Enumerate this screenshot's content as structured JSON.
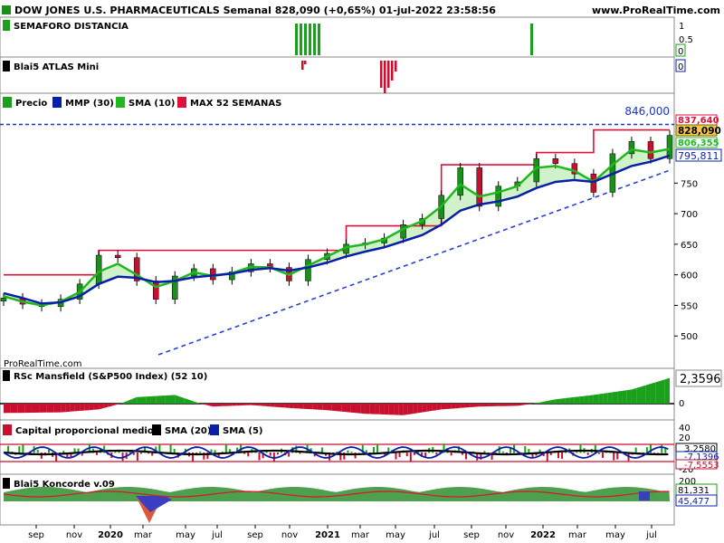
{
  "header": {
    "title": "DOW JONES U.S. PHARMACEUTICALS Semanal 828,090 (+0,65%) 01-jul-2022 23:58:56",
    "site": "www.ProRealTime.com"
  },
  "watermark": "ProRealTime.com",
  "panels": {
    "semaforo": {
      "label": "SEMAFORO DISTANCIA",
      "ticks": [
        "1",
        "0.5",
        "0"
      ],
      "last_value": "0"
    },
    "atlas": {
      "label": "Blai5 ATLAS Mini",
      "ticks": [
        "0"
      ],
      "last_value": "0"
    },
    "price": {
      "legend": [
        "Precio",
        "MMP (30)",
        "SMA (10)",
        "MAX 52 SEMANAS"
      ],
      "ticks": [
        "750",
        "700",
        "650",
        "600",
        "550",
        "500"
      ],
      "label_846": "846,000",
      "val_max": "837,640",
      "val_price": "828,090",
      "val_sma": "806,355",
      "val_mmp": "795,811"
    },
    "rsc": {
      "label": "RSc Mansfield (S&P500 Index) (52 10)",
      "ticks": [
        "0"
      ],
      "value": "2,3596"
    },
    "capital": {
      "legend": [
        "Capital proporcional medio",
        "SMA (20)",
        "SMA (5)"
      ],
      "ticks": [
        "40",
        "20",
        "0",
        "-20"
      ],
      "values": [
        "3,2580",
        "-7,1396",
        "-7,5553"
      ]
    },
    "koncorde": {
      "label": "Blai5 Koncorde v.09",
      "ticks": [
        "200"
      ],
      "values": [
        "81,331",
        "45,477"
      ]
    }
  },
  "x_axis": [
    "sep",
    "nov",
    "2020",
    "mar",
    "may",
    "jul",
    "sep",
    "nov",
    "2021",
    "mar",
    "may",
    "jul",
    "sep",
    "nov",
    "2022",
    "mar",
    "may",
    "jul"
  ],
  "colors": {
    "up": "#1a8f1a",
    "down": "#c8102e",
    "mmp": "#0a1fa8",
    "sma10": "#1fb81f",
    "max52": "#e0103a",
    "trend": "#2a3fd6",
    "bar_green": "#1aa01a",
    "bar_red": "#c8102e"
  },
  "chart_data": [
    {
      "type": "line",
      "title": "DOW JONES U.S. PHARMACEUTICALS Semanal",
      "x": [
        "2019-08",
        "2019-09",
        "2019-10",
        "2019-11",
        "2019-12",
        "2020-01",
        "2020-02",
        "2020-03",
        "2020-04",
        "2020-05",
        "2020-06",
        "2020-07",
        "2020-08",
        "2020-09",
        "2020-10",
        "2020-11",
        "2020-12",
        "2021-01",
        "2021-02",
        "2021-03",
        "2021-04",
        "2021-05",
        "2021-06",
        "2021-07",
        "2021-08",
        "2021-09",
        "2021-10",
        "2021-11",
        "2021-12",
        "2022-01",
        "2022-02",
        "2022-03",
        "2022-04",
        "2022-05",
        "2022-06",
        "2022-07"
      ],
      "series": [
        {
          "name": "Precio",
          "values": [
            562,
            552,
            548,
            560,
            585,
            632,
            628,
            590,
            560,
            598,
            610,
            592,
            605,
            618,
            612,
            590,
            625,
            635,
            650,
            652,
            660,
            682,
            692,
            730,
            775,
            712,
            745,
            752,
            790,
            782,
            765,
            735,
            798,
            818,
            790,
            828
          ]
        },
        {
          "name": "MMP (30)",
          "values": [
            570,
            562,
            553,
            555,
            565,
            585,
            597,
            595,
            588,
            590,
            596,
            599,
            602,
            608,
            611,
            607,
            612,
            620,
            630,
            638,
            645,
            655,
            665,
            682,
            705,
            715,
            720,
            728,
            742,
            752,
            755,
            752,
            765,
            778,
            785,
            795
          ]
        },
        {
          "name": "SMA (10)",
          "values": [
            565,
            556,
            550,
            556,
            572,
            605,
            618,
            600,
            580,
            590,
            604,
            598,
            603,
            613,
            612,
            600,
            615,
            630,
            645,
            650,
            658,
            675,
            688,
            712,
            748,
            728,
            735,
            745,
            775,
            778,
            770,
            752,
            780,
            805,
            800,
            806
          ]
        },
        {
          "name": "MAX 52 SEMANAS",
          "values": [
            600,
            600,
            600,
            600,
            600,
            640,
            640,
            640,
            640,
            640,
            640,
            640,
            640,
            640,
            640,
            640,
            640,
            640,
            680,
            680,
            680,
            680,
            680,
            780,
            780,
            780,
            780,
            780,
            800,
            800,
            800,
            837,
            837,
            837,
            837,
            837
          ]
        }
      ],
      "ylim": [
        450,
        860
      ],
      "annotations": [
        "846,000"
      ]
    },
    {
      "type": "area",
      "title": "RSc Mansfield (S&P500 Index) (52 10)",
      "x": [
        "2019-08",
        "2019-11",
        "2020-01",
        "2020-03",
        "2020-05",
        "2020-07",
        "2020-09",
        "2020-11",
        "2021-01",
        "2021-03",
        "2021-05",
        "2021-07",
        "2021-09",
        "2021-11",
        "2022-01",
        "2022-03",
        "2022-05",
        "2022-07"
      ],
      "values": [
        -1.3,
        -1.2,
        -0.8,
        0.6,
        0.8,
        -0.4,
        -0.2,
        -0.6,
        -0.9,
        -1.4,
        -1.6,
        -0.8,
        -0.4,
        -0.3,
        0.4,
        0.8,
        1.3,
        2.36
      ],
      "ylim": [
        -2,
        3
      ]
    }
  ]
}
